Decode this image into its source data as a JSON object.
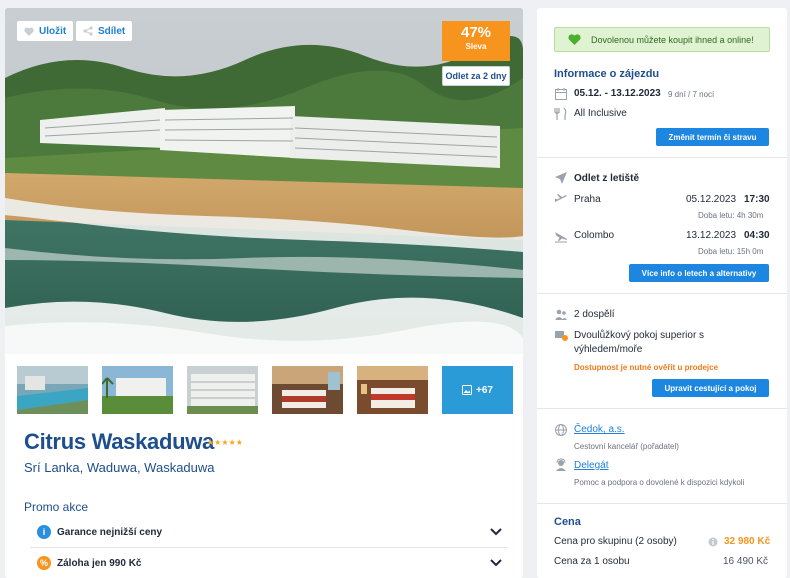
{
  "gallery": {
    "save_label": "Uložit",
    "share_label": "Sdílet",
    "discount_percent": "47%",
    "discount_label": "Sleva",
    "departure_tag": "Odlet za 2 dny",
    "more_photos": "+67"
  },
  "hotel": {
    "name": "Citrus Waskaduwa",
    "stars": "★★★★★",
    "star_count": 5,
    "location": "Srí Lanka, Waduwa, Waskaduwa"
  },
  "promo": {
    "title": "Promo akce",
    "items": [
      {
        "label": "Garance nejnižší ceny",
        "icon": "info-icon"
      },
      {
        "label": "Záloha jen 990 Kč",
        "icon": "percent-icon"
      }
    ]
  },
  "sidebar": {
    "banner": "Dovolenou můžete koupit ihned a online!",
    "trip_info": {
      "title": "Informace o zájezdu",
      "dates": "05.12. - 13.12.2023",
      "duration": "9 dní / 7 nocí",
      "board": "All Inclusive",
      "change_button": "Změnit termín či stravu"
    },
    "flight": {
      "title": "Odlet z letiště",
      "outbound": {
        "city": "Praha",
        "date": "05.12.2023",
        "time": "17:30",
        "duration": "Doba letu: 4h 30m"
      },
      "inbound": {
        "city": "Colombo",
        "date": "13.12.2023",
        "time": "04:30",
        "duration": "Doba letu: 15h 0m"
      },
      "more_button": "Více info o letech a alternativy"
    },
    "travelers": {
      "count": "2 dospělí",
      "room": "Dvoulůžkový pokoj superior s výhledem/moře",
      "availability_warning": "Dostupnost je nutné ověřit u prodejce",
      "edit_button": "Upravit cestující a pokoj"
    },
    "agency": {
      "name": "Čedok, a.s.",
      "role": "Cestovní kancelář (pořadatel)",
      "delegate": "Delegát",
      "delegate_note": "Pomoc a podpora o dovolené k dispozici kdykoli"
    },
    "price": {
      "title": "Cena",
      "group_label": "Cena pro skupinu (2 osoby)",
      "group_value": "32 980 Kč",
      "person_label": "Cena za 1 osobu",
      "person_value": "16 490 Kč"
    }
  },
  "colors": {
    "accent_blue": "#1d86e0",
    "brand_dark_blue": "#1e4e8c",
    "discount_orange": "#f7941d",
    "banner_green": "#dff2d2"
  }
}
